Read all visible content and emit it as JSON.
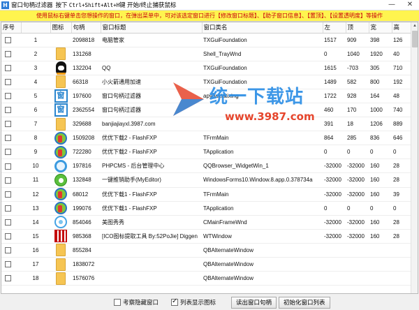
{
  "window": {
    "app_icon": "H",
    "title": "窗口句柄过滤器",
    "hotkey_prefix": "按下",
    "hotkey_combo": "Ctrl+Shift+Alt+H",
    "hotkey_suffix": "键 开始/终止捕获鼠标",
    "minimize": "—",
    "close": "✕"
  },
  "notice": "使用鼠标右键单击您想操作的窗口，在弹出菜单中，可对该选定窗口进行【修改窗口标题】、【助子窗口信息】、【置顶】、【设置透明度】等操作",
  "columns": [
    "序号",
    "",
    "图标",
    "句柄",
    "窗口标题",
    "窗口类名",
    "左",
    "顶",
    "宽",
    "高"
  ],
  "rows": [
    {
      "n": "1",
      "icon": "none",
      "handle": "2098818",
      "title": "电脑管家",
      "cls": "TXGuiFoundation",
      "left": "1517",
      "top": "909",
      "w": "398",
      "h": "126"
    },
    {
      "n": "2",
      "icon": "folder",
      "handle": "131268",
      "title": "",
      "cls": "Shell_TrayWnd",
      "left": "0",
      "top": "1040",
      "w": "1920",
      "h": "40"
    },
    {
      "n": "3",
      "icon": "qq",
      "handle": "132204",
      "title": "QQ",
      "cls": "TXGuiFoundation",
      "left": "1615",
      "top": "-703",
      "w": "305",
      "h": "710"
    },
    {
      "n": "4",
      "icon": "folder",
      "handle": "66318",
      "title": "小火箭通用加速",
      "cls": "TXGuiFoundation",
      "left": "1489",
      "top": "582",
      "w": "800",
      "h": "192"
    },
    {
      "n": "5",
      "icon": "box",
      "handle": "197600",
      "title": "窗口句柄过滤器",
      "cls": "apyouxiatixing",
      "left": "1722",
      "top": "928",
      "w": "164",
      "h": "48"
    },
    {
      "n": "6",
      "icon": "box",
      "handle": "2362554",
      "title": "窗口句柄过滤器",
      "cls": "",
      "left": "460",
      "top": "170",
      "w": "1000",
      "h": "740"
    },
    {
      "n": "7",
      "icon": "folder",
      "handle": "329688",
      "title": "banjiajiayxl.3987.com",
      "cls": "",
      "left": "391",
      "top": "18",
      "w": "1206",
      "h": "889"
    },
    {
      "n": "8",
      "icon": "fxp",
      "handle": "1509208",
      "title": "优优下载2 - FlashFXP",
      "cls": "TFrmMain",
      "left": "864",
      "top": "285",
      "w": "836",
      "h": "646"
    },
    {
      "n": "9",
      "icon": "fxp",
      "handle": "722280",
      "title": "优优下载2 - FlashFXP",
      "cls": "TApplication",
      "left": "0",
      "top": "0",
      "w": "0",
      "h": "0"
    },
    {
      "n": "10",
      "icon": "ring",
      "handle": "197816",
      "title": "PHPCMS - 后台管理中心",
      "cls": "QQBrowser_WidgetWin_1",
      "left": "-32000",
      "top": "-32000",
      "w": "160",
      "h": "28"
    },
    {
      "n": "11",
      "icon": "green",
      "handle": "132848",
      "title": "一键推销助手(MyEditor)",
      "cls": "WindowsForms10.Window.8.app.0.378734a",
      "left": "-32000",
      "top": "-32000",
      "w": "160",
      "h": "28"
    },
    {
      "n": "12",
      "icon": "fxp",
      "handle": "68012",
      "title": "优优下载1 - FlashFXP",
      "cls": "TFrmMain",
      "left": "-32000",
      "top": "-32000",
      "w": "160",
      "h": "39"
    },
    {
      "n": "13",
      "icon": "fxp",
      "handle": "199076",
      "title": "优优下载1 - FlashFXP",
      "cls": "TApplication",
      "left": "0",
      "top": "0",
      "w": "0",
      "h": "0"
    },
    {
      "n": "14",
      "icon": "mei",
      "handle": "854046",
      "title": "美图秀秀",
      "cls": "CMainFrameWnd",
      "left": "-32000",
      "top": "-32000",
      "w": "160",
      "h": "28"
    },
    {
      "n": "15",
      "icon": "qr",
      "handle": "985368",
      "title": "[ICO图标提取工具 By:52PoJie] Diggen",
      "cls": "WTWindow",
      "left": "-32000",
      "top": "-32000",
      "w": "160",
      "h": "28"
    },
    {
      "n": "16",
      "icon": "folder",
      "handle": "855284",
      "title": "",
      "cls": "QBAlternateWindow",
      "left": "",
      "top": "",
      "w": "",
      "h": ""
    },
    {
      "n": "17",
      "icon": "folder",
      "handle": "1838072",
      "title": "",
      "cls": "QBAlternateWindow",
      "left": "",
      "top": "",
      "w": "",
      "h": ""
    },
    {
      "n": "18",
      "icon": "folder",
      "handle": "1576076",
      "title": "",
      "cls": "QBAlternateWindow",
      "left": "",
      "top": "",
      "w": "",
      "h": ""
    }
  ],
  "watermark": {
    "text": "统一下载站",
    "url": "www.3987.com"
  },
  "footer": {
    "show_hidden": "考察隐藏窗口",
    "show_hidden_checked": false,
    "list_icons": "列表显示图标",
    "list_icons_checked": true,
    "read_button": "读出窗口句柄",
    "init_button": "初始化窗口列表"
  }
}
